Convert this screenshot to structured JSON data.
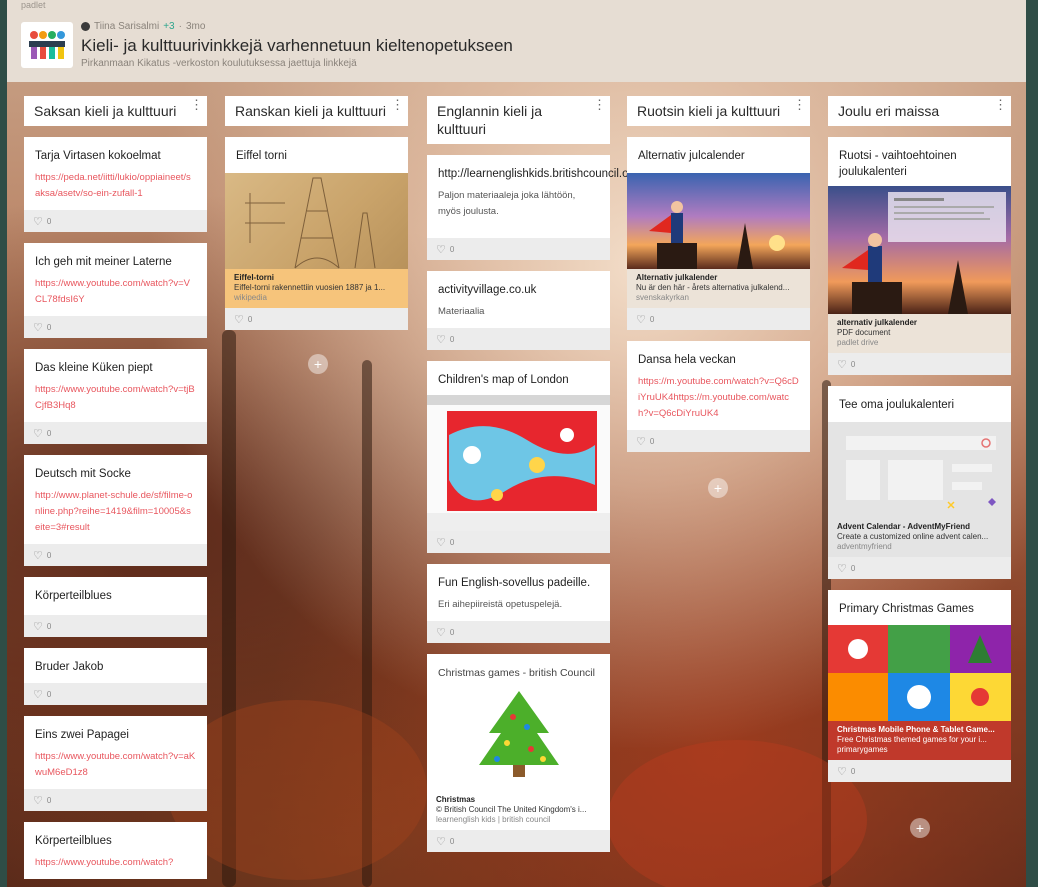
{
  "header": {
    "brand": "padlet",
    "author": "Tiina Sarisalmi",
    "contributors": "+3",
    "age": "3mo",
    "title": "Kieli- ja kulttuurivinkkejä varhennetuun kieltenopetukseen",
    "subtitle": "Pirkanmaan Kikatus -verkoston koulutuksessa jaettuja linkkejä"
  },
  "columns": [
    {
      "title": "Saksan kieli ja kulttuuri",
      "cards": [
        {
          "title": "Tarja Virtasen kokoelmat",
          "link": "https://peda.net/iitti/lukio/oppiaineet/saksa/asetv/so-ein-zufall-1",
          "likes": "0"
        },
        {
          "title": "Ich geh mit meiner Laterne",
          "link": "https://www.youtube.com/watch?v=VCL78fdsI6Y",
          "likes": "0"
        },
        {
          "title": "Das kleine Küken piept",
          "link": "https://www.youtube.com/watch?v=tjBCjfB3Hq8",
          "likes": "0"
        },
        {
          "title": "Deutsch mit Socke",
          "link": "http://www.planet-schule.de/sf/filme-online.php?reihe=1419&film=10005&seite=3#result",
          "likes": "0"
        },
        {
          "title": "Körperteilblues",
          "likes": "0"
        },
        {
          "title": "Bruder Jakob",
          "likes": "0"
        },
        {
          "title": "Eins zwei Papagei",
          "link": "https://www.youtube.com/watch?v=aKwuM6eD1z8",
          "likes": "0"
        },
        {
          "title": "Körperteilblues",
          "link": "https://www.youtube.com/watch?"
        }
      ]
    },
    {
      "title": "Ranskan kieli ja kulttuuri",
      "cards": [
        {
          "title": "Eiffel torni",
          "att_title": "Eiffel-torni",
          "att_desc": "Eiffel-torni rakennettiin vuosien 1887 ja 1...",
          "att_src": "wikipedia",
          "likes": "0"
        }
      ]
    },
    {
      "title": "Englannin kieli ja kulttuuri",
      "cards": [
        {
          "title": "http://learnenglishkids.britishcouncil.org/en",
          "body": "Paljon materiaaleja joka lähtöön, myös joulusta.",
          "likes": "0"
        },
        {
          "title": "activityvillage.co.uk",
          "body": "Materiaalia",
          "likes": "0"
        },
        {
          "title": "Children's map of London",
          "likes": "0"
        },
        {
          "title": "Fun English-sovellus padeille.",
          "body": "Eri aihepiireistä opetuspelejä.",
          "likes": "0"
        },
        {
          "title": "Christmas games - british Council",
          "att_title": "Christmas",
          "att_desc": "© British Council The United Kingdom's i...",
          "att_src": "learnenglish kids | british council",
          "likes": "0"
        }
      ]
    },
    {
      "title": "Ruotsin kieli ja kulttuuri",
      "cards": [
        {
          "title": "Alternativ julcalender",
          "att_title": "Alternativ julkalender",
          "att_desc": "Nu är den här - årets alternativa julkalend...",
          "att_src": "svenskakyrkan",
          "likes": "0"
        },
        {
          "title": "Dansa hela veckan",
          "link": "https://m.youtube.com/watch?v=Q6cDiYruUK4https://m.youtube.com/watch?v=Q6cDiYruUK4",
          "likes": "0"
        }
      ]
    },
    {
      "title": "Joulu eri maissa",
      "cards": [
        {
          "title": "Ruotsi - vaihtoehtoinen joulukalenteri",
          "att_title": "alternativ julkalender",
          "att_desc": "PDF document",
          "att_src": "padlet drive",
          "likes": "0"
        },
        {
          "title": "Tee oma joulukalenteri",
          "att_title": "Advent Calendar - AdventMyFriend",
          "att_desc": "Create a customized online advent calen...",
          "att_src": "adventmyfriend",
          "likes": "0"
        },
        {
          "title": "Primary Christmas Games",
          "att_title": "Christmas Mobile Phone & Tablet Game...",
          "att_desc": "Free Christmas themed games for your i...",
          "att_src": "primarygames",
          "likes": "0"
        }
      ]
    }
  ],
  "icons": {
    "menu": "more-vert-icon",
    "like": "heart-icon",
    "add": "plus-icon"
  },
  "colors": {
    "link": "#e8565e",
    "accent": "#2fa58d",
    "header_bg": "#e6ddd3"
  }
}
